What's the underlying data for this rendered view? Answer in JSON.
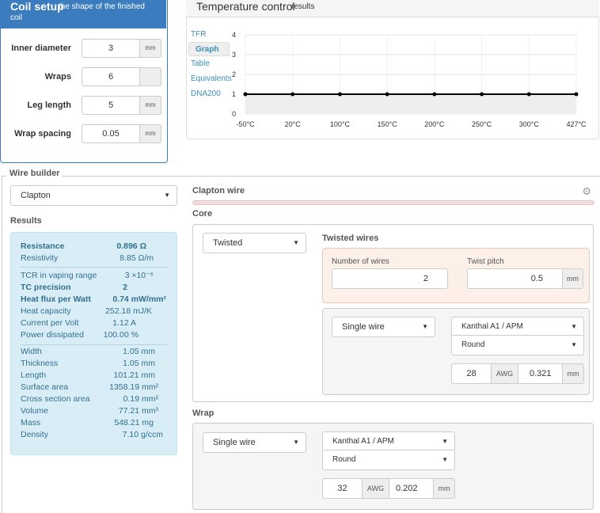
{
  "coil": {
    "title": "Coil setup",
    "subtitle_1": "the shape of the finished",
    "subtitle_2": "coil",
    "rows": [
      {
        "label": "Inner diameter",
        "value": "3",
        "unit": "mm"
      },
      {
        "label": "Wraps",
        "value": "6",
        "unit": ""
      },
      {
        "label": "Leg length",
        "value": "5",
        "unit": "mm"
      },
      {
        "label": "Wrap spacing",
        "value": "0.05",
        "unit": "mm"
      }
    ]
  },
  "temp": {
    "title": "Temperature control",
    "subtitle": "results",
    "nav": [
      "TFR",
      "Graph",
      "Table",
      "Equivalents",
      "DNA200"
    ],
    "active_nav": "Graph"
  },
  "chart_data": {
    "type": "line",
    "categories": [
      "-50°C",
      "20°C",
      "100°C",
      "150°C",
      "200°C",
      "250°C",
      "300°C",
      "427°C"
    ],
    "series": [
      {
        "values": [
          1,
          1,
          1,
          1,
          1,
          1,
          1,
          1
        ]
      }
    ],
    "y_ticks": [
      "0",
      "1",
      "2",
      "3",
      "4"
    ],
    "ylim": [
      0,
      4
    ],
    "grid": true,
    "line_color": "#000000",
    "fill_color": "#eeeeee"
  },
  "wire_builder": {
    "label": "Wire builder",
    "wire_type": "Clapton",
    "results_label": "Results",
    "results_group1": [
      {
        "label": "Resistance",
        "value": "0.896 Ω",
        "bold": true
      },
      {
        "label": "Resistivity",
        "value": "8.85 Ω/m",
        "bold": false
      }
    ],
    "results_group2": [
      {
        "label": "TCR in vaping range",
        "value": "3 ×10⁻⁶",
        "bold": false
      },
      {
        "label": "TC precision",
        "value": "2",
        "bold": true
      },
      {
        "label": "Heat flux per Watt",
        "value": "0.74 mW/mm²",
        "bold": true
      },
      {
        "label": "Heat capacity",
        "value": "252.18 mJ/K",
        "bold": false
      },
      {
        "label": "Current per Volt",
        "value": "1.12 A",
        "bold": false
      },
      {
        "label": "Power dissipated",
        "value": "100.00 %",
        "bold": false
      }
    ],
    "results_group3": [
      {
        "label": "Width",
        "value": "1.05 mm"
      },
      {
        "label": "Thickness",
        "value": "1.05 mm"
      },
      {
        "label": "Length",
        "value": "101.21 mm"
      },
      {
        "label": "Surface area",
        "value": "1358.19 mm²"
      },
      {
        "label": "Cross section area",
        "value": "0.19 mm²"
      },
      {
        "label": "Volume",
        "value": "77.21 mm³"
      },
      {
        "label": "Mass",
        "value": "548.21 mg"
      },
      {
        "label": "Density",
        "value": "7.10 g/ccm"
      }
    ]
  },
  "clapton": {
    "title": "Clapton wire",
    "core_label": "Core",
    "core_type": "Twisted",
    "twisted_label": "Twisted wires",
    "num_wires_label": "Number of wires",
    "num_wires": "2",
    "twist_pitch_label": "Twist pitch",
    "twist_pitch": "0.5",
    "twist_unit": "mm",
    "core_wire_type": "Single wire",
    "core_material": "Kanthal A1 / APM",
    "core_shape": "Round",
    "core_awg": "28",
    "core_awg_label": "AWG",
    "core_mm": "0.321",
    "core_mm_unit": "mm",
    "wrap_label": "Wrap",
    "wrap_type": "Single wire",
    "wrap_material": "Kanthal A1 / APM",
    "wrap_shape": "Round",
    "wrap_awg": "32",
    "wrap_awg_label": "AWG",
    "wrap_mm": "0.202",
    "wrap_mm_unit": "mm"
  }
}
